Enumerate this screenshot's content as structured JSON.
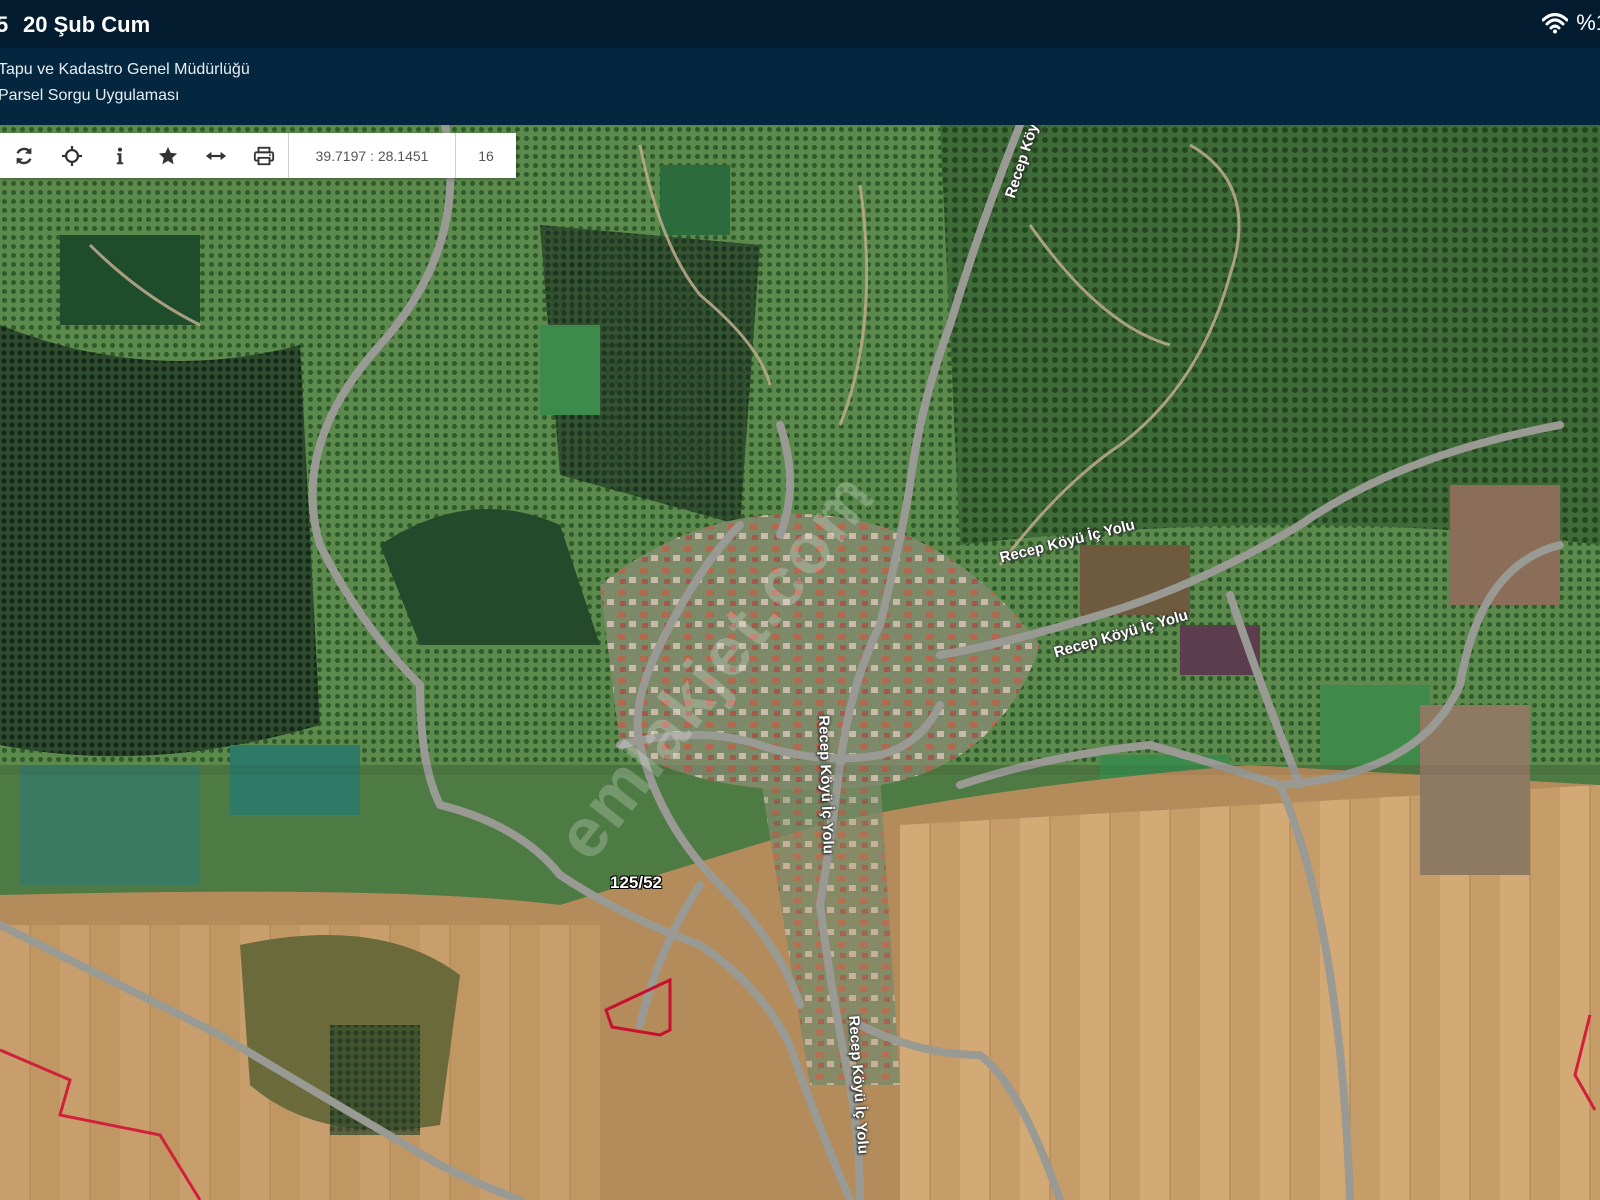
{
  "status_bar": {
    "time": "5",
    "date": "20 Şub Cum",
    "battery": "%1",
    "icons": [
      "wifi-icon"
    ]
  },
  "header": {
    "org_name": "Tapu ve Kadastro Genel Müdürlüğü",
    "app_name": "Parsel Sorgu Uygulaması"
  },
  "toolbar": {
    "buttons": [
      "refresh-icon",
      "locate-icon",
      "info-icon",
      "star-icon",
      "measure-icon",
      "print-icon"
    ],
    "coordinates": "39.7197 : 28.1451",
    "zoom": "16"
  },
  "map": {
    "imagery": "satellite",
    "road_labels": [
      "Recep Köyü",
      "Recep Köyü İç Yolu",
      "Recep Köyü İç Yolu",
      "Recep Köyü İç Yolu",
      "Recep Köyü İç Yolu"
    ],
    "parcel_label": "125/52",
    "parcel_color": "#c8102e",
    "watermark": "emlakjet.com"
  },
  "colors": {
    "status_bar_bg": "#041c30",
    "header_bg": "#04263e",
    "toolbar_bg": "#ffffff"
  }
}
